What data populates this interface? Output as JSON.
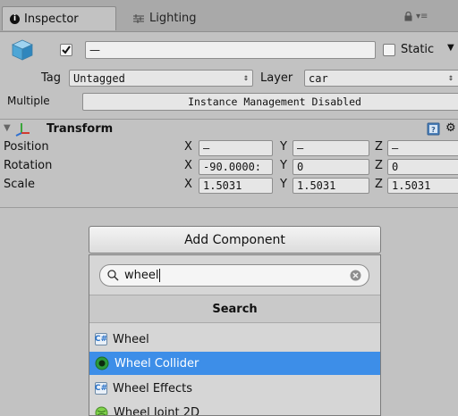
{
  "tabs": {
    "inspector_label": "Inspector",
    "lighting_label": "Lighting",
    "menu_glyph": "▾≡"
  },
  "object": {
    "name_value": "—",
    "static_label": "Static",
    "tag_label": "Tag",
    "tag_value": "Untagged",
    "layer_label": "Layer",
    "layer_value": "car",
    "multiple_label": "Multiple",
    "multiple_value": "Instance Management Disabled"
  },
  "transform": {
    "title": "Transform",
    "rows": [
      {
        "label": "Position",
        "x": "—",
        "y": "—",
        "z": "—"
      },
      {
        "label": "Rotation",
        "x": "-90.0000:",
        "y": "0",
        "z": "0"
      },
      {
        "label": "Scale",
        "x": "1.5031",
        "y": "1.5031",
        "z": "1.5031"
      }
    ],
    "axis_x": "X",
    "axis_y": "Y",
    "axis_z": "Z"
  },
  "add_component": {
    "button_label": "Add Component",
    "search_value": "wheel",
    "section_header": "Search",
    "items": [
      {
        "label": "Wheel",
        "icon": "script-icon"
      },
      {
        "label": "Wheel Collider",
        "icon": "wheel-collider-icon"
      },
      {
        "label": "Wheel Effects",
        "icon": "script-icon"
      },
      {
        "label": "Wheel Joint 2D",
        "icon": "wheel-joint-icon"
      }
    ]
  },
  "colors": {
    "selection": "#3d8ee8",
    "panel_bg": "#c2c2c2"
  }
}
